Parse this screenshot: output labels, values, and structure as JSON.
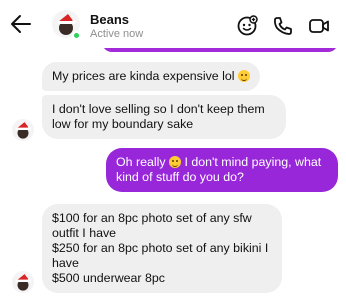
{
  "header": {
    "name": "Beans",
    "status": "Active now"
  },
  "messages": [
    {
      "id": "m1",
      "side": "incoming",
      "text": "My prices are kinda expensive lol",
      "emoji": "crying-laughing-emoji"
    },
    {
      "id": "m2",
      "side": "incoming",
      "text": "I don't love selling so I don't keep them low for my boundary sake"
    },
    {
      "id": "m3",
      "side": "outgoing",
      "text_before": "Oh really",
      "emoji": "smiling-face-emoji",
      "text_after": "I don't mind paying, what kind of stuff do you do?"
    },
    {
      "id": "m4",
      "side": "incoming",
      "lines": [
        "$100 for an 8pc photo set of any sfw outfit I have",
        "$250 for an 8pc photo set of any bikini I have",
        "$500 underwear 8pc"
      ]
    }
  ],
  "colors": {
    "outgoing_bubble": "#9827da",
    "incoming_bubble": "#efefef",
    "online": "#2bd35a"
  },
  "icons": [
    "back-arrow-icon",
    "add-sticker-icon",
    "phone-icon",
    "video-camera-icon"
  ]
}
